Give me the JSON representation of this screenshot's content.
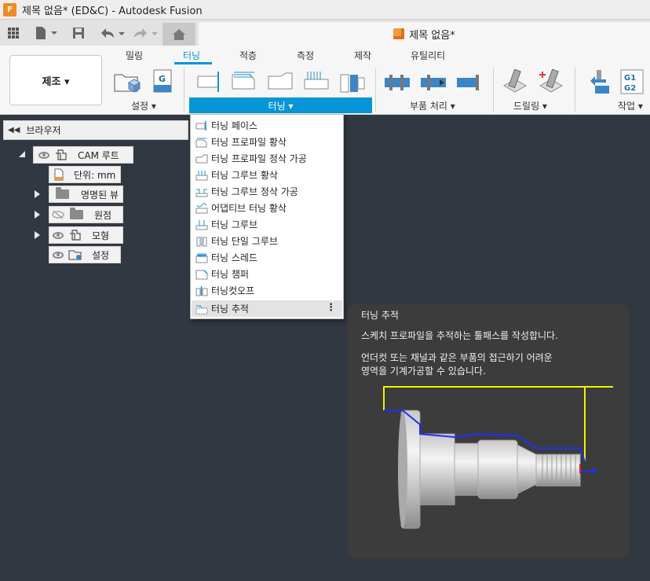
{
  "window": {
    "title": "제목 없음* (ED&C) - Autodesk Fusion",
    "logo_letter": "F"
  },
  "document_tab": {
    "title": "제목 없음*"
  },
  "ribbon": {
    "workspace": "제조 ▾",
    "tabs": [
      "밀링",
      "터닝",
      "적층",
      "측정",
      "제작",
      "유틸리티"
    ],
    "active_tab": "터닝",
    "groups": {
      "setup": "설정 ▾",
      "turning": "터닝 ▾",
      "part_handling": "부품 처리 ▾",
      "drilling": "드릴링 ▾",
      "actions": "작업 ▾"
    },
    "gcode_icon_text": "G1\nG2",
    "setup_g_icon": "G"
  },
  "browser": {
    "title": "브라우저",
    "root": "CAM 루트",
    "units": "단위: mm",
    "items": [
      "명명된 뷰",
      "원점",
      "모형",
      "설정"
    ]
  },
  "turning_menu": {
    "items": [
      "터닝 페이스",
      "터닝 프로파일 황삭",
      "터닝 프로파일 정삭 가공",
      "터닝 그루브 황삭",
      "터닝 그루브 정삭 가공",
      "어댑티브 터닝 황삭",
      "터닝 그루브",
      "터닝 단일 그루브",
      "터닝 스레드",
      "터닝 챔퍼",
      "터닝컷오프",
      "터닝 추적"
    ],
    "highlighted_index": 11,
    "more_icon": "more-vertical-icon"
  },
  "tooltip": {
    "title": "터닝 추적",
    "description": "스케치 프로파일을 추적하는 툴패스를 작성합니다.",
    "detail_line1": "언더컷 또는 채널과 같은 부품의 접근하기 어려운",
    "detail_line2": "영역을 기계가공할 수 있습니다."
  },
  "colors": {
    "accent": "#0696d7",
    "canvas": "#323842",
    "tooltip_bg": "#3c3c3c",
    "toolpath_yellow": "#f2f200",
    "toolpath_blue": "#1f2fff"
  }
}
